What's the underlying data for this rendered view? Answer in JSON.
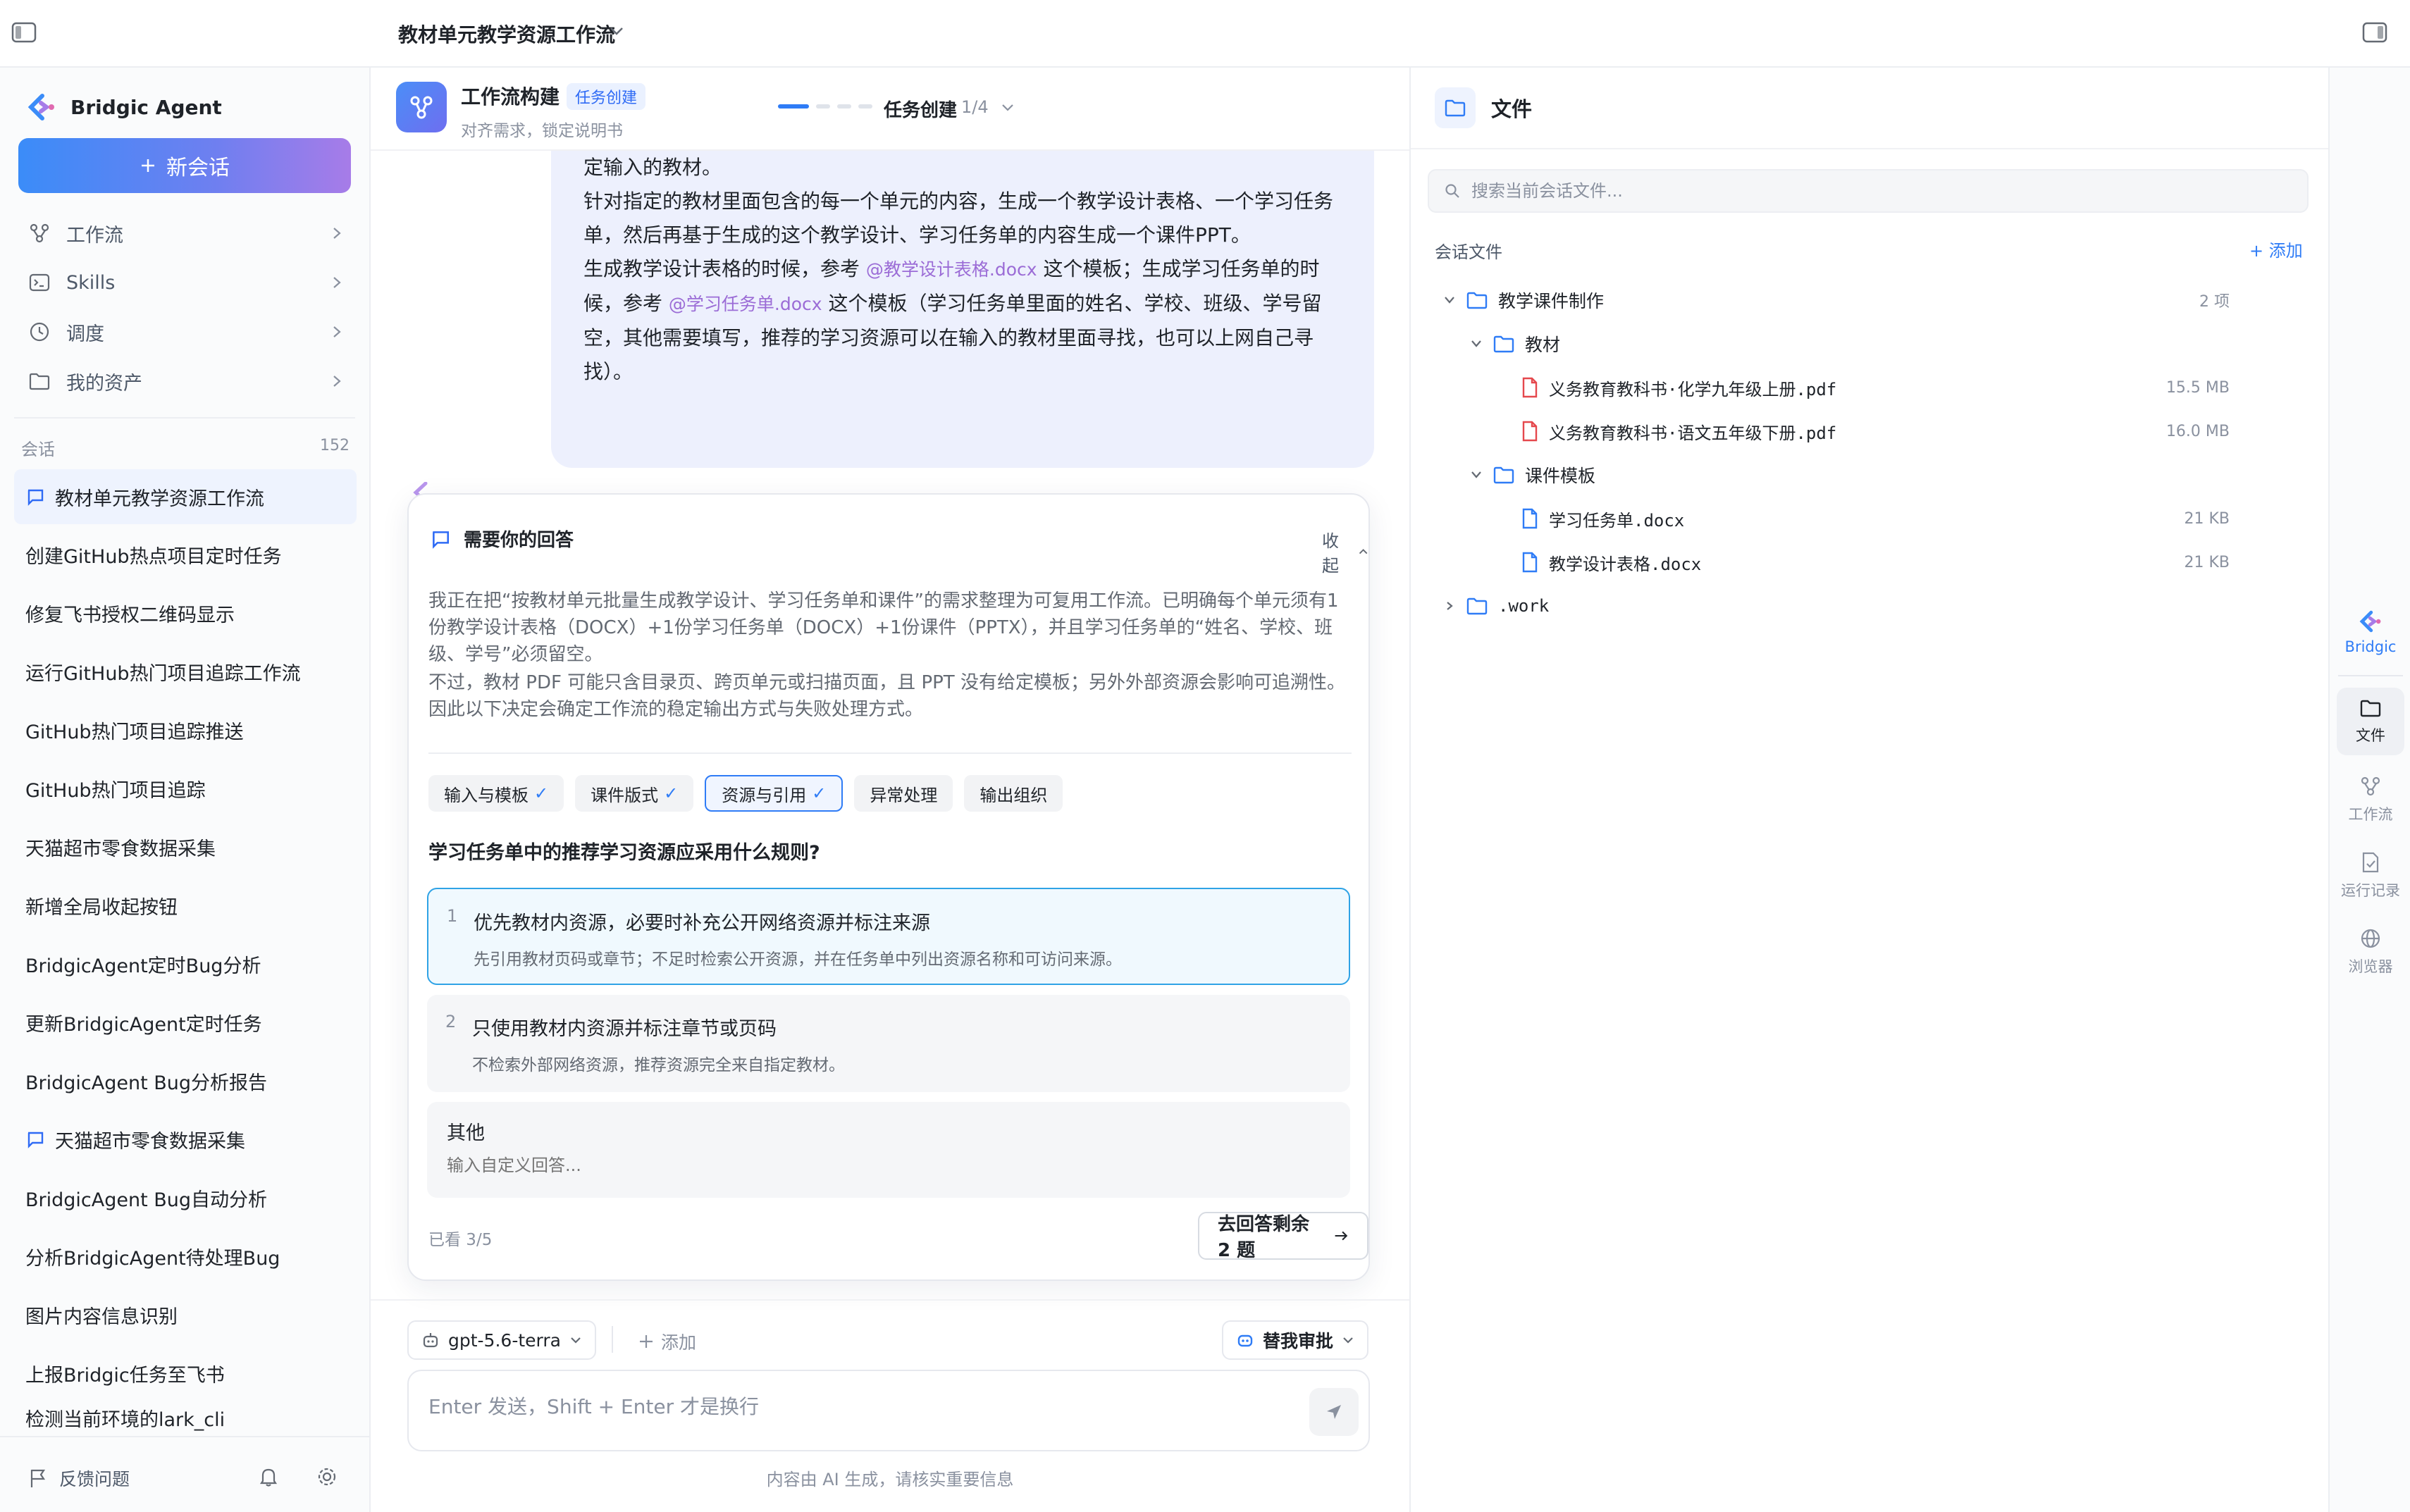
{
  "topbar": {
    "title": "教材单元教学资源工作流"
  },
  "sidebar": {
    "brand": "Bridgic Agent",
    "new_chat": "新会话",
    "nav": [
      {
        "label": "工作流",
        "icon": "workflow-icon"
      },
      {
        "label": "Skills",
        "icon": "terminal-icon"
      },
      {
        "label": "调度",
        "icon": "clock-icon"
      },
      {
        "label": "我的资产",
        "icon": "folder-icon"
      }
    ],
    "section_label": "会话",
    "section_count": "152",
    "sessions": [
      {
        "label": "教材单元教学资源工作流",
        "active": true,
        "icon": true
      },
      {
        "label": "创建GitHub热点项目定时任务"
      },
      {
        "label": "修复飞书授权二维码显示"
      },
      {
        "label": "运行GitHub热门项目追踪工作流"
      },
      {
        "label": "GitHub热门项目追踪推送"
      },
      {
        "label": "GitHub热门项目追踪"
      },
      {
        "label": "天猫超市零食数据采集"
      },
      {
        "label": "新增全局收起按钮"
      },
      {
        "label": "BridgicAgent定时Bug分析"
      },
      {
        "label": "更新BridgicAgent定时任务"
      },
      {
        "label": "BridgicAgent Bug分析报告"
      },
      {
        "label": "天猫超市零食数据采集",
        "icon": true
      },
      {
        "label": "BridgicAgent Bug自动分析"
      },
      {
        "label": "分析BridgicAgent待处理Bug"
      },
      {
        "label": "图片内容信息识别"
      },
      {
        "label": "上报Bridgic任务至飞书"
      },
      {
        "label": "检测当前环境的lark_cli"
      }
    ],
    "feedback": "反馈问题"
  },
  "main": {
    "workflow_title": "工作流构建",
    "workflow_tag": "任务创建",
    "workflow_sub": "对齐需求，锁定说明书",
    "progress_steps": 4,
    "progress_current": 1,
    "step_label": "任务创建",
    "step_count": "1/4",
    "bubble": {
      "line1": "定输入的教材。",
      "line2": "针对指定的教材里面包含的每一个单元的内容，生成一个教学设计表格、一个学习任务",
      "line3": "单，然后再基于生成的这个教学设计、学习任务单的内容生成一个课件PPT。",
      "line4a": "生成教学设计表格的时候，参考",
      "mention1": "@教学设计表格.docx",
      "line4b": "这个模板；生成学习任务单的时",
      "line5a": "候，参考",
      "mention2": "@学习任务单.docx",
      "line5b": "这个模板（学习任务单里面的姓名、学校、班级、学号留",
      "line6": "空，其他需要填写，推荐的学习资源可以在输入的教材里面寻找，也可以上网自己寻",
      "line7": "找）。"
    },
    "question_card": {
      "header": "需要你的回答",
      "collapse": "收起",
      "desc1": "我正在把“按教材单元批量生成教学设计、学习任务单和课件”的需求整理为可复用工作流。已明确每个单元须有1份教学设计表格（DOCX）+1份学习任务单（DOCX）+1份课件（PPTX），并且学习任务单的“姓名、学校、班级、学号”必须留空。",
      "desc2": "不过，教材 PDF 可能只含目录页、跨页单元或扫描页面，且 PPT 没有给定模板；另外外部资源会影响可追溯性。因此以下决定会确定工作流的稳定输出方式与失败处理方式。",
      "tabs": [
        {
          "label": "输入与模板",
          "done": "✓"
        },
        {
          "label": "课件版式",
          "done": "✓"
        },
        {
          "label": "资源与引用",
          "done": "✓",
          "selected": true
        },
        {
          "label": "异常处理"
        },
        {
          "label": "输出组织"
        }
      ],
      "question": "学习任务单中的推荐学习资源应采用什么规则?",
      "options": [
        {
          "num": "1",
          "title": "优先教材内资源，必要时补充公开网络资源并标注来源",
          "desc": "先引用教材页码或章节；不足时检索公开资源，并在任务单中列出资源名称和可访问来源。"
        },
        {
          "num": "2",
          "title": "只使用教材内资源并标注章节或页码",
          "desc": "不检索外部网络资源，推荐资源完全来自指定教材。"
        }
      ],
      "other_label": "其他",
      "other_placeholder": "输入自定义回答...",
      "seen": "已看 3/5",
      "go_answer": "去回答剩余 2 题"
    },
    "composer": {
      "model": "gpt-5.6-terra",
      "add": "添加",
      "approve": "替我审批",
      "placeholder": "Enter 发送，Shift + Enter 才是换行"
    },
    "disclaimer": "内容由 AI 生成，请核实重要信息"
  },
  "files": {
    "title": "文件",
    "search_placeholder": "搜索当前会话文件...",
    "section_label": "会话文件",
    "add": "添加",
    "tree": {
      "root": {
        "name": "教学课件制作",
        "meta": "2 项"
      },
      "folder1": {
        "name": "教材"
      },
      "file1": {
        "name": "义务教育教科书·化学九年级上册.pdf",
        "meta": "15.5 MB"
      },
      "file2": {
        "name": "义务教育教科书·语文五年级下册.pdf",
        "meta": "16.0 MB"
      },
      "folder2": {
        "name": "课件模板"
      },
      "file3": {
        "name": "学习任务单.docx",
        "meta": "21 KB"
      },
      "file4": {
        "name": "教学设计表格.docx",
        "meta": "21 KB"
      },
      "work": {
        "name": ".work"
      }
    }
  },
  "rail": {
    "items": [
      {
        "label": "Bridgic"
      },
      {
        "label": "文件"
      },
      {
        "label": "工作流"
      },
      {
        "label": "运行记录"
      },
      {
        "label": "浏览器"
      }
    ]
  },
  "colors": {
    "accent": "#2f7cf6",
    "mention": "#9b6cd6",
    "brand_gradient_start": "#3b8cf8",
    "brand_gradient_end": "#a77ce8"
  }
}
